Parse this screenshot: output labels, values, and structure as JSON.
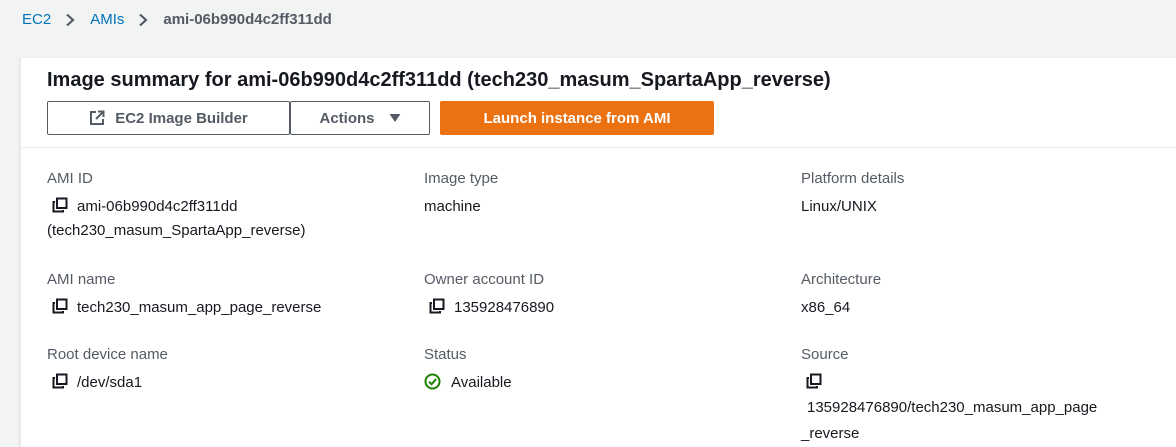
{
  "breadcrumb": {
    "items": [
      "EC2",
      "AMIs"
    ],
    "current": "ami-06b990d4c2ff311dd"
  },
  "panel": {
    "title": "Image summary for ami-06b990d4c2ff311dd (tech230_masum_SpartaApp_reverse)",
    "buttons": {
      "builder": "EC2 Image Builder",
      "actions": "Actions",
      "launch": "Launch instance from AMI"
    }
  },
  "details": {
    "ami_id": {
      "label": "AMI ID",
      "value": "ami-06b990d4c2ff311dd",
      "value_line2": "(tech230_masum_SpartaApp_reverse)"
    },
    "image_type": {
      "label": "Image type",
      "value": "machine"
    },
    "platform_details": {
      "label": "Platform details",
      "value": "Linux/UNIX"
    },
    "ami_name": {
      "label": "AMI name",
      "value": "tech230_masum_app_page_reverse"
    },
    "owner_account_id": {
      "label": "Owner account ID",
      "value": "135928476890"
    },
    "architecture": {
      "label": "Architecture",
      "value": "x86_64"
    },
    "root_device_name": {
      "label": "Root device name",
      "value": "/dev/sda1"
    },
    "status": {
      "label": "Status",
      "value": "Available"
    },
    "source": {
      "label": "Source",
      "value_line1": "135928476890/tech230_masum_app_page",
      "value_line2": "_reverse"
    }
  },
  "icons": {
    "copy": "copy-icon",
    "external": "external-link-icon",
    "caret": "caret-down-icon",
    "check": "status-check-icon",
    "chevron": "chevron-right-icon"
  },
  "colors": {
    "link": "#0073bb",
    "primary": "#ec7211",
    "success": "#1d8102",
    "label": "#545b64"
  }
}
